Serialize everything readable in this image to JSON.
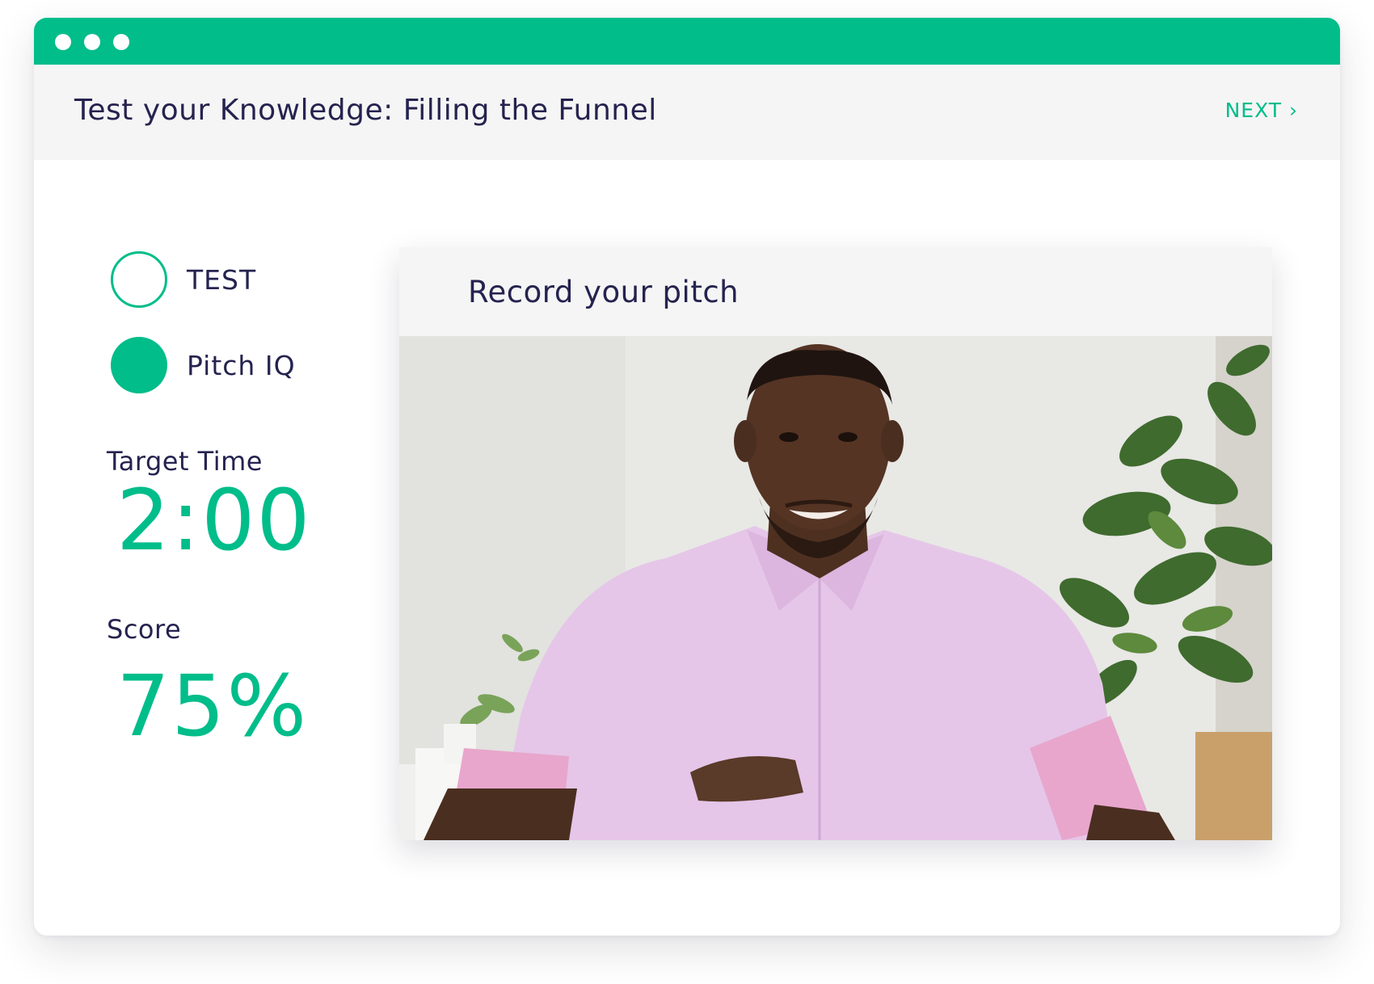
{
  "window": {
    "controls": [
      "dot",
      "dot",
      "dot"
    ]
  },
  "header": {
    "title": "Test your Knowledge: Filling the Funnel",
    "next_label": "NEXT ›"
  },
  "steps": [
    {
      "label": "TEST",
      "state": "outline"
    },
    {
      "label": "Pitch IQ",
      "state": "filled"
    }
  ],
  "stats": {
    "target_time_label": "Target Time",
    "target_time_value": "2:00",
    "score_label": "Score",
    "score_value": "75%"
  },
  "card": {
    "title": "Record your pitch",
    "video": "man-in-pink-shirt-speaking"
  },
  "colors": {
    "accent": "#00bd8a",
    "text": "#25234f",
    "header_bg": "#f5f5f5"
  }
}
